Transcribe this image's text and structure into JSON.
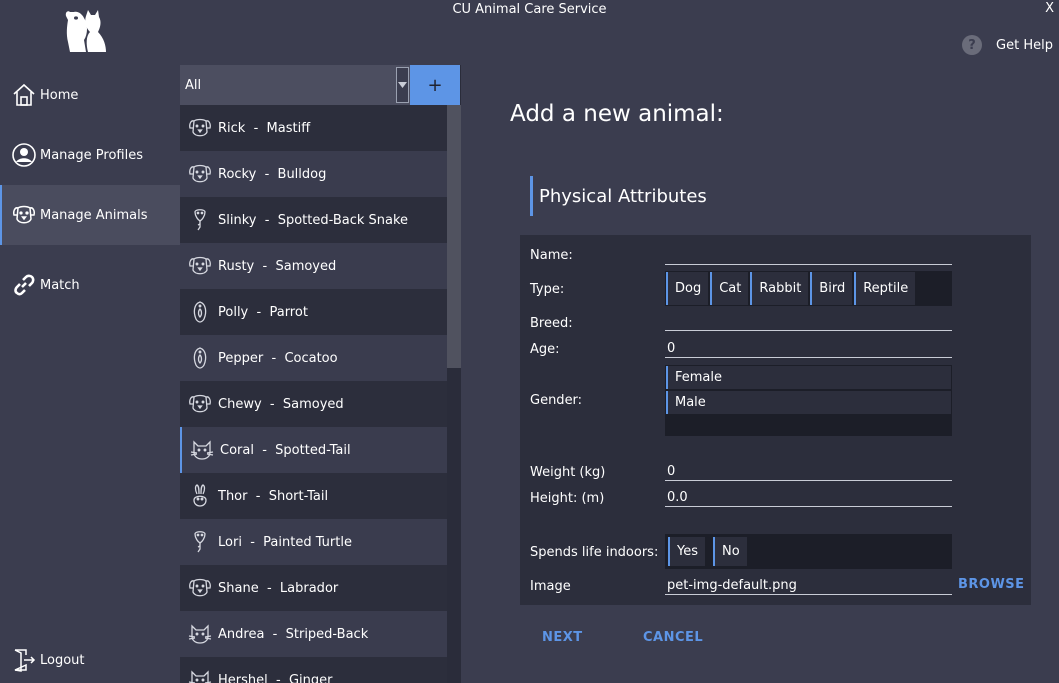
{
  "window": {
    "title": "CU Animal Care Service",
    "close_label": "X"
  },
  "logo": {
    "icon": "cat-dog-logo-icon"
  },
  "help": {
    "icon_glyph": "?",
    "label": "Get Help"
  },
  "nav": {
    "home": "Home",
    "profiles": "Manage Profiles",
    "animals": "Manage Animals",
    "match": "Match",
    "logout": "Logout",
    "active": "Manage Animals"
  },
  "filter": {
    "value": "All",
    "add_label": "+"
  },
  "animals": [
    {
      "name": "Rick",
      "breed": "Mastiff",
      "icon": "dog"
    },
    {
      "name": "Rocky",
      "breed": "Bulldog",
      "icon": "dog"
    },
    {
      "name": "Slinky",
      "breed": "Spotted-Back Snake",
      "icon": "reptile"
    },
    {
      "name": "Rusty",
      "breed": "Samoyed",
      "icon": "dog"
    },
    {
      "name": "Polly",
      "breed": "Parrot",
      "icon": "bird"
    },
    {
      "name": "Pepper",
      "breed": "Cocatoo",
      "icon": "bird"
    },
    {
      "name": "Chewy",
      "breed": "Samoyed",
      "icon": "dog"
    },
    {
      "name": "Coral",
      "breed": "Spotted-Tail",
      "icon": "cat",
      "selected": true
    },
    {
      "name": "Thor",
      "breed": "Short-Tail",
      "icon": "rabbit"
    },
    {
      "name": "Lori",
      "breed": "Painted Turtle",
      "icon": "reptile"
    },
    {
      "name": "Shane",
      "breed": "Labrador",
      "icon": "dog"
    },
    {
      "name": "Andrea",
      "breed": "Striped-Back",
      "icon": "cat"
    },
    {
      "name": "Hershel",
      "breed": "Ginger",
      "icon": "cat"
    }
  ],
  "separator": "  -  ",
  "form": {
    "page_title": "Add a new animal:",
    "section_title": "Physical Attributes",
    "labels": {
      "name": "Name:",
      "type": "Type:",
      "breed": "Breed:",
      "age": "Age:",
      "gender": "Gender:",
      "weight": "Weight (kg)",
      "height": "Height: (m)",
      "indoors": "Spends life indoors:",
      "image": "Image"
    },
    "values": {
      "name": "",
      "breed": "",
      "age": "0",
      "weight": "0",
      "height": "0.0",
      "image": "pet-img-default.png"
    },
    "type_options": [
      "Dog",
      "Cat",
      "Rabbit",
      "Bird",
      "Reptile"
    ],
    "gender_options": [
      "Female",
      "Male"
    ],
    "indoors_options": [
      "Yes",
      "No"
    ],
    "browse_label": "BROWSE",
    "next_label": "NEXT",
    "cancel_label": "CANCEL"
  },
  "colors": {
    "accent": "#5d95e6",
    "background": "#3b3d4f",
    "panel": "#2c2e3c"
  }
}
